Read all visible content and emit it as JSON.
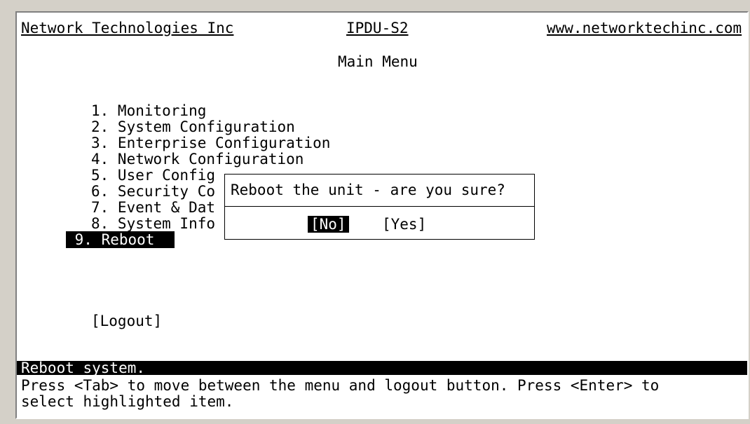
{
  "header": {
    "company": "Network Technologies Inc",
    "model": "IPDU-S2",
    "url": "www.networktechinc.com"
  },
  "title": "Main Menu",
  "menu": [
    {
      "label": "1. Monitoring"
    },
    {
      "label": "2. System Configuration"
    },
    {
      "label": "3. Enterprise Configuration"
    },
    {
      "label": "4. Network Configuration"
    },
    {
      "label": "5. User Config"
    },
    {
      "label": "6. Security Co"
    },
    {
      "label": "7. Event & Dat"
    },
    {
      "label": "8. System Info"
    },
    {
      "label": " 9. Reboot",
      "selected": true
    }
  ],
  "logout_label": "[Logout]",
  "dialog": {
    "question": "Reboot the unit - are you sure?",
    "no_label": "[No]",
    "yes_label": "[Yes]"
  },
  "status": "Reboot system.",
  "help": [
    "Press <Tab> to move between the menu and logout button. Press <Enter> to",
    "select highlighted item."
  ]
}
